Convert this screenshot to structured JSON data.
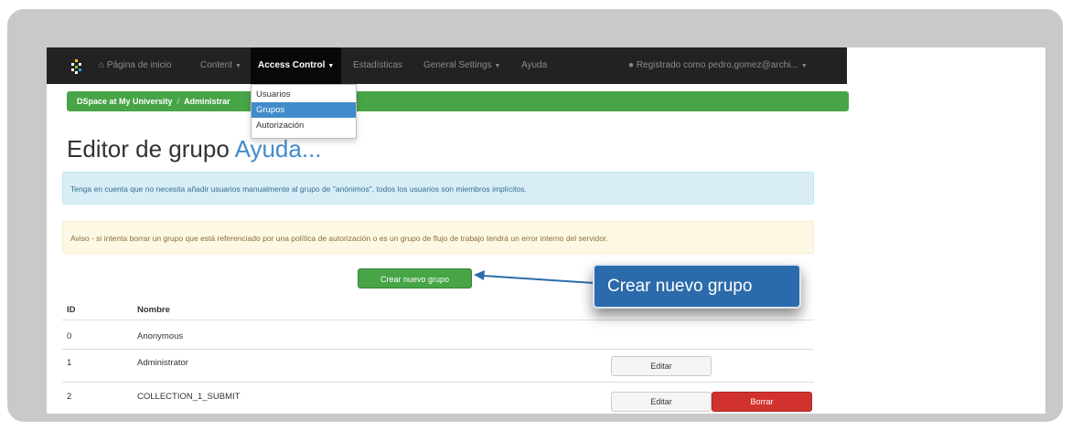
{
  "navbar": {
    "home_label": "Página de inicio",
    "content_label": "Content",
    "access_control_label": "Access Control",
    "stats_label": "Estadísticas",
    "general_settings_label": "General Settings",
    "help_label": "Ayuda",
    "user_label": "Registrado como pedro.gomez@archi..."
  },
  "dropdown": {
    "items": [
      "Usuarios",
      "Grupos",
      "Autorización"
    ],
    "selected": "Grupos"
  },
  "breadcrumb": {
    "root": "DSpace at My University",
    "current": "Administrar"
  },
  "page": {
    "title": "Editor de grupo",
    "help_link": "Ayuda..."
  },
  "alerts": {
    "info": "Tenga en cuenta que no necesita añadir usuarios manualmente al grupo de \"anónimos\", todos los usuarios son miembros implícitos.",
    "warning": "Aviso - si intenta borrar un grupo que está referenciado por una política de autorización o es un grupo de flujo de trabajo tendrá un error interno del servidor."
  },
  "create_button": "Crear nuevo grupo",
  "callout": "Crear nuevo grupo",
  "table": {
    "headers": {
      "id": "ID",
      "name": "Nombre"
    },
    "rows": [
      {
        "id": "0",
        "name": "Anonymous"
      },
      {
        "id": "1",
        "name": "Administrator",
        "edit": "Editar"
      },
      {
        "id": "2",
        "name": "COLLECTION_1_SUBMIT",
        "edit": "Editar",
        "delete": "Borrar"
      }
    ]
  },
  "colors": {
    "navbar": "#222222",
    "success": "#47a447",
    "link": "#428bca",
    "danger": "#d2322d",
    "callout": "#2c6bab"
  }
}
